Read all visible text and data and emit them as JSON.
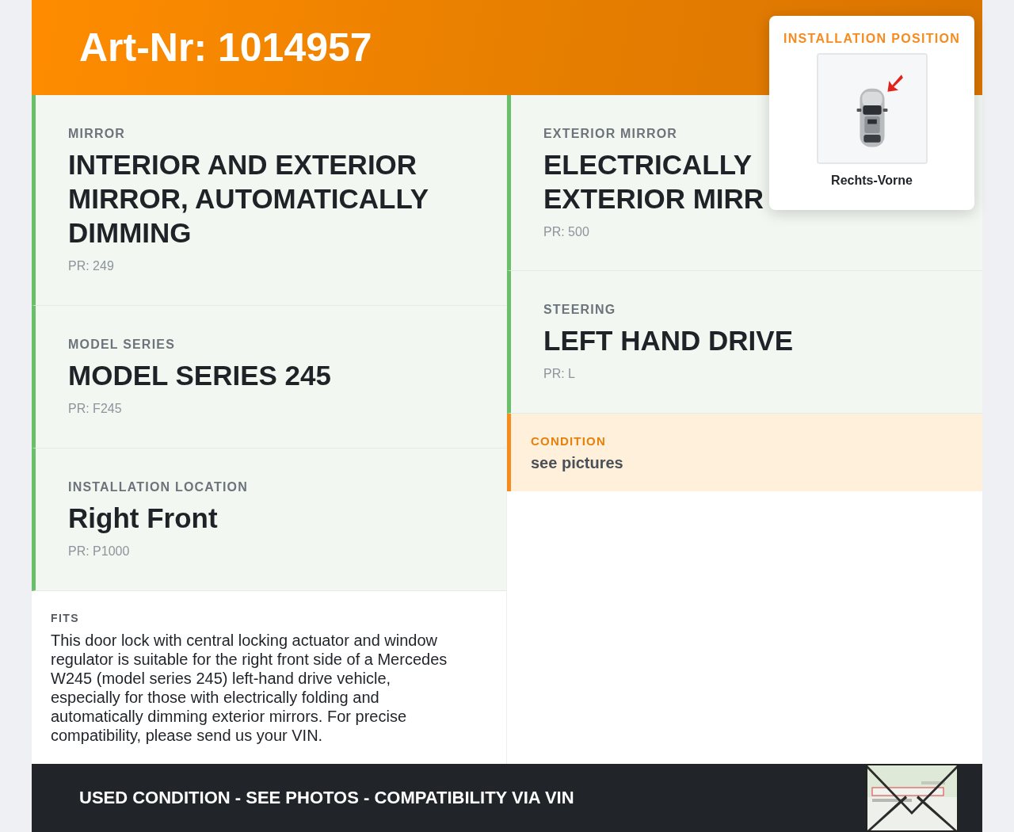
{
  "header": {
    "title": "Art-Nr: 1014957"
  },
  "left_cards": [
    {
      "label": "MIRROR",
      "title_lines": [
        "INTERIOR AND EXTERIOR",
        "MIRROR, AUTOMATICALLY",
        "DIMMING"
      ],
      "pr": "PR: 249"
    },
    {
      "label": "MODEL SERIES",
      "title_lines": [
        "MODEL SERIES 245"
      ],
      "pr": "PR: F245"
    },
    {
      "label": "INSTALLATION LOCATION",
      "title_lines": [
        "Right Front"
      ],
      "pr": "PR: P1000"
    }
  ],
  "fits": {
    "label": "FITS",
    "text": "This door lock with central locking actuator and window regulator is suitable for the right front side of a Mercedes W245 (model series 245) left-hand drive vehicle, especially for those with electrically folding and automatically dimming exterior mirrors. For precise compatibility, please send us your VIN."
  },
  "right_cards": [
    {
      "label": "EXTERIOR MIRROR",
      "title_lines": [
        "ELECTRICALLY",
        "EXTERIOR MIRR"
      ],
      "pr": "PR: 500"
    },
    {
      "label": "STEERING",
      "title_lines": [
        "LEFT HAND DRIVE"
      ],
      "pr": "PR: L"
    }
  ],
  "condition": {
    "label": "CONDITION",
    "text": "see pictures"
  },
  "installation_popup": {
    "title": "INSTALLATION POSITION",
    "caption": "Rechts-Vorne"
  },
  "footer": {
    "text": "USED CONDITION - SEE PHOTOS - COMPATIBILITY VIA VIN"
  }
}
